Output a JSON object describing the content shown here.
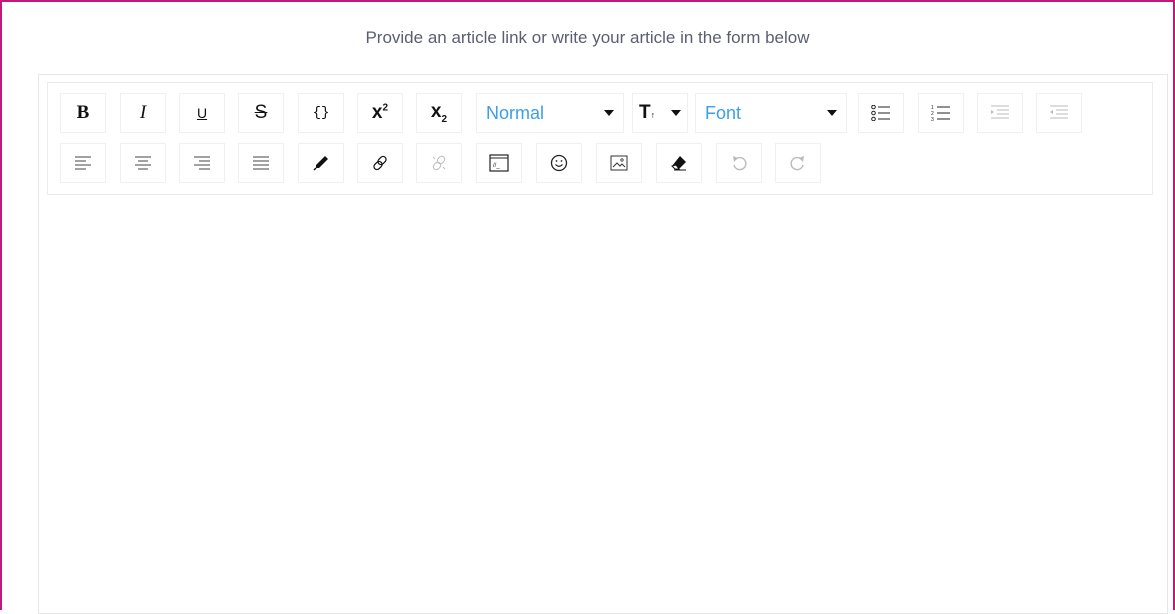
{
  "instruction": "Provide an article link or write your article in the form below",
  "toolbar": {
    "bold_label": "B",
    "italic_label": "I",
    "underline_label": "U",
    "strike_label": "S",
    "code_label": "{}",
    "superscript_base": "x",
    "superscript_exp": "2",
    "subscript_base": "x",
    "subscript_exp": "2",
    "block_type": {
      "selected": "Normal"
    },
    "font_size_label": "T",
    "font_family": {
      "selected": "Font"
    },
    "icons": [
      "bold-icon",
      "italic-icon",
      "underline-icon",
      "strikethrough-icon",
      "code-icon",
      "superscript-icon",
      "subscript-icon",
      "font-size-icon",
      "unordered-list-icon",
      "ordered-list-icon",
      "indent-icon",
      "outdent-icon",
      "align-left-icon",
      "align-center-icon",
      "align-right-icon",
      "align-justify-icon",
      "color-picker-icon",
      "link-icon",
      "unlink-icon",
      "embed-icon",
      "emoji-icon",
      "image-icon",
      "eraser-icon",
      "undo-icon",
      "redo-icon"
    ]
  },
  "colors": {
    "frame_border": "#c2187a",
    "dropdown_text": "#3aa0e8",
    "instruction_text": "#5b5e72"
  }
}
